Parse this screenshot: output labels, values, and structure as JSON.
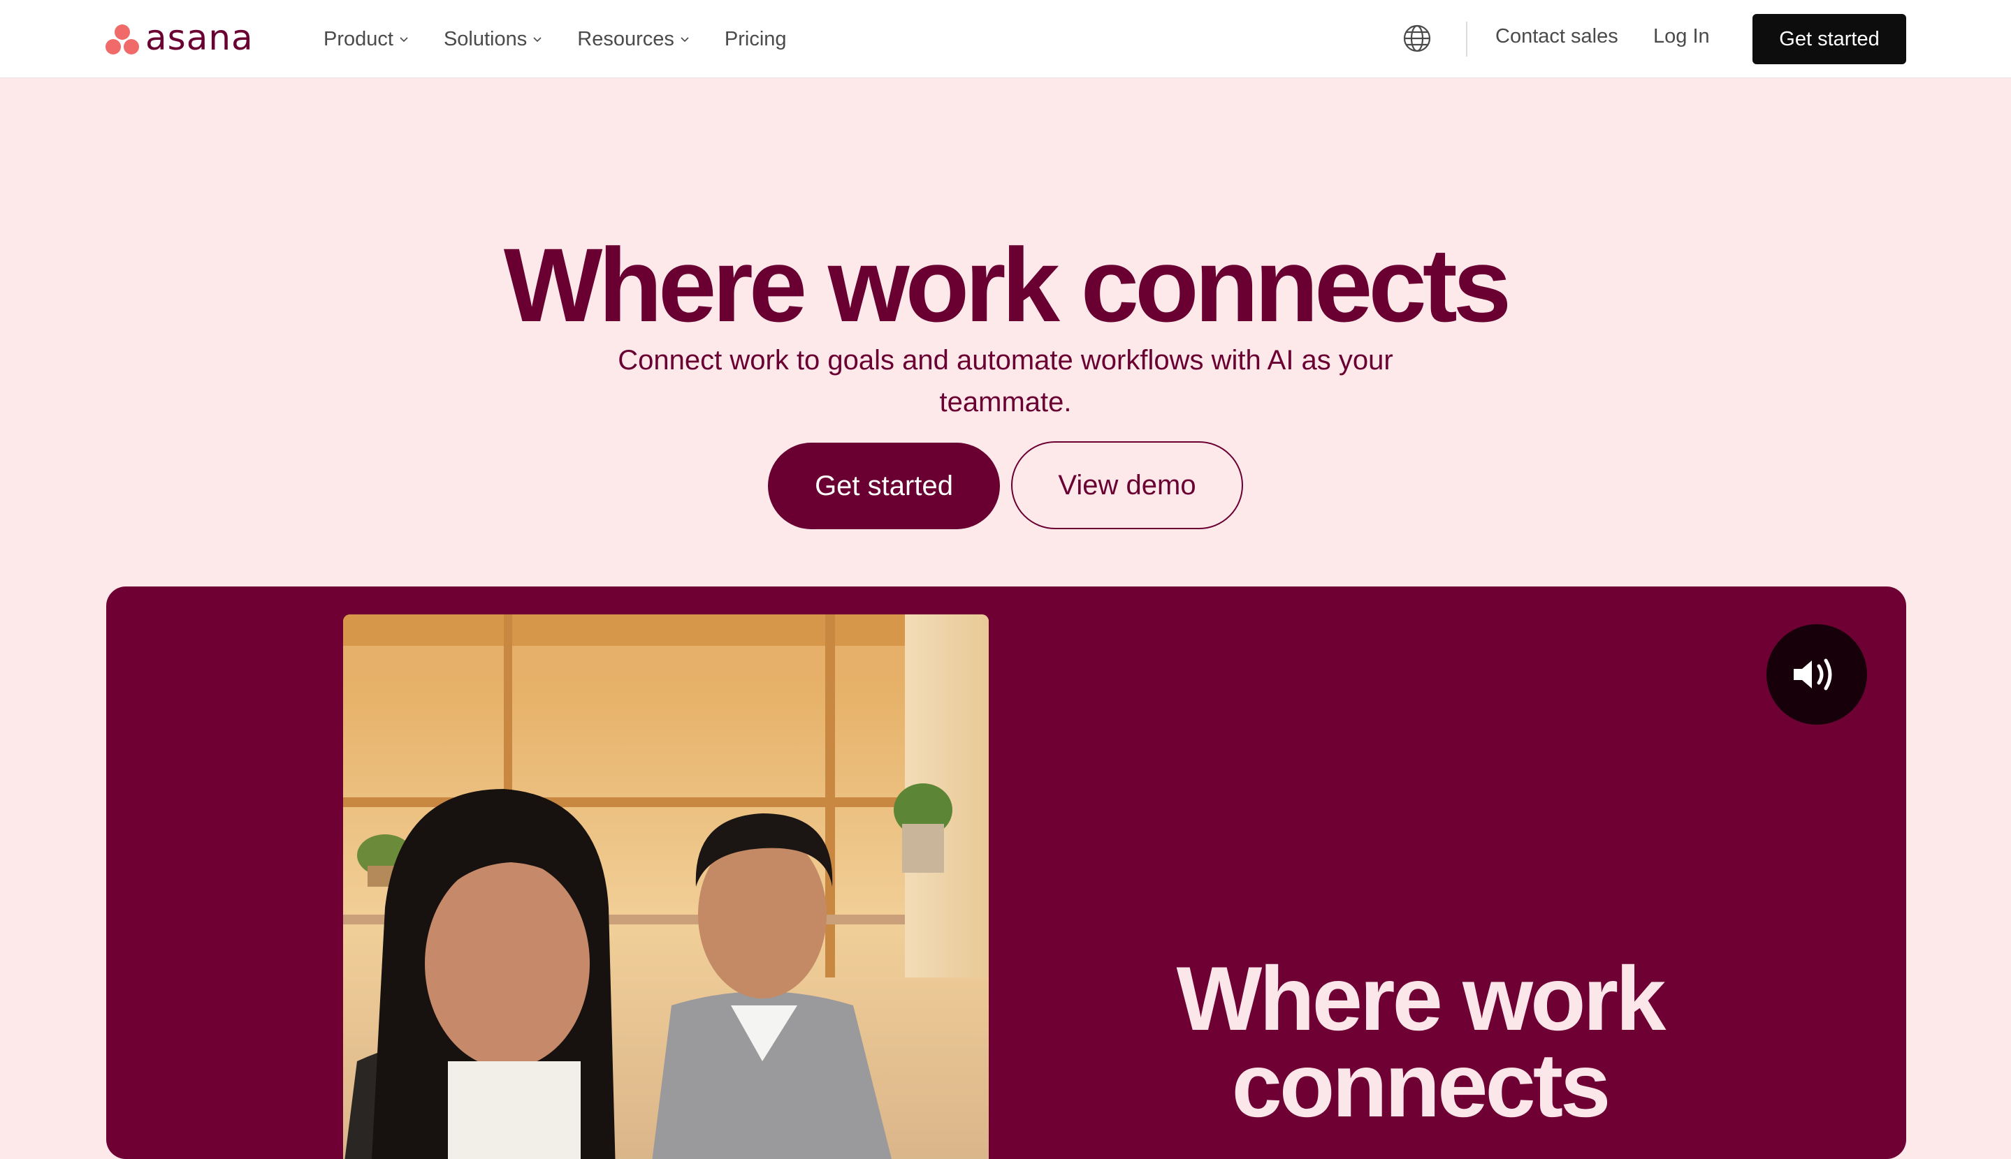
{
  "brand": {
    "name": "asana",
    "dot_color": "#f06a6a",
    "text_color": "#690031"
  },
  "nav": {
    "items": [
      {
        "label": "Product",
        "has_dropdown": true
      },
      {
        "label": "Solutions",
        "has_dropdown": true
      },
      {
        "label": "Resources",
        "has_dropdown": true
      },
      {
        "label": "Pricing",
        "has_dropdown": false
      }
    ],
    "language_icon": "globe-icon",
    "contact_label": "Contact sales",
    "login_label": "Log In",
    "cta_label": "Get started"
  },
  "hero": {
    "title": "Where work connects",
    "subtitle": "Connect work to goals and automate workflows with AI as your teammate.",
    "primary_cta": "Get started",
    "secondary_cta": "View demo"
  },
  "video": {
    "caption": "Where work connects",
    "sound_icon": "speaker-on-icon",
    "panel_color": "#6f0033"
  },
  "colors": {
    "page_background": "#fde8ea",
    "accent": "#690031",
    "nav_cta": "#0d0d0d"
  }
}
